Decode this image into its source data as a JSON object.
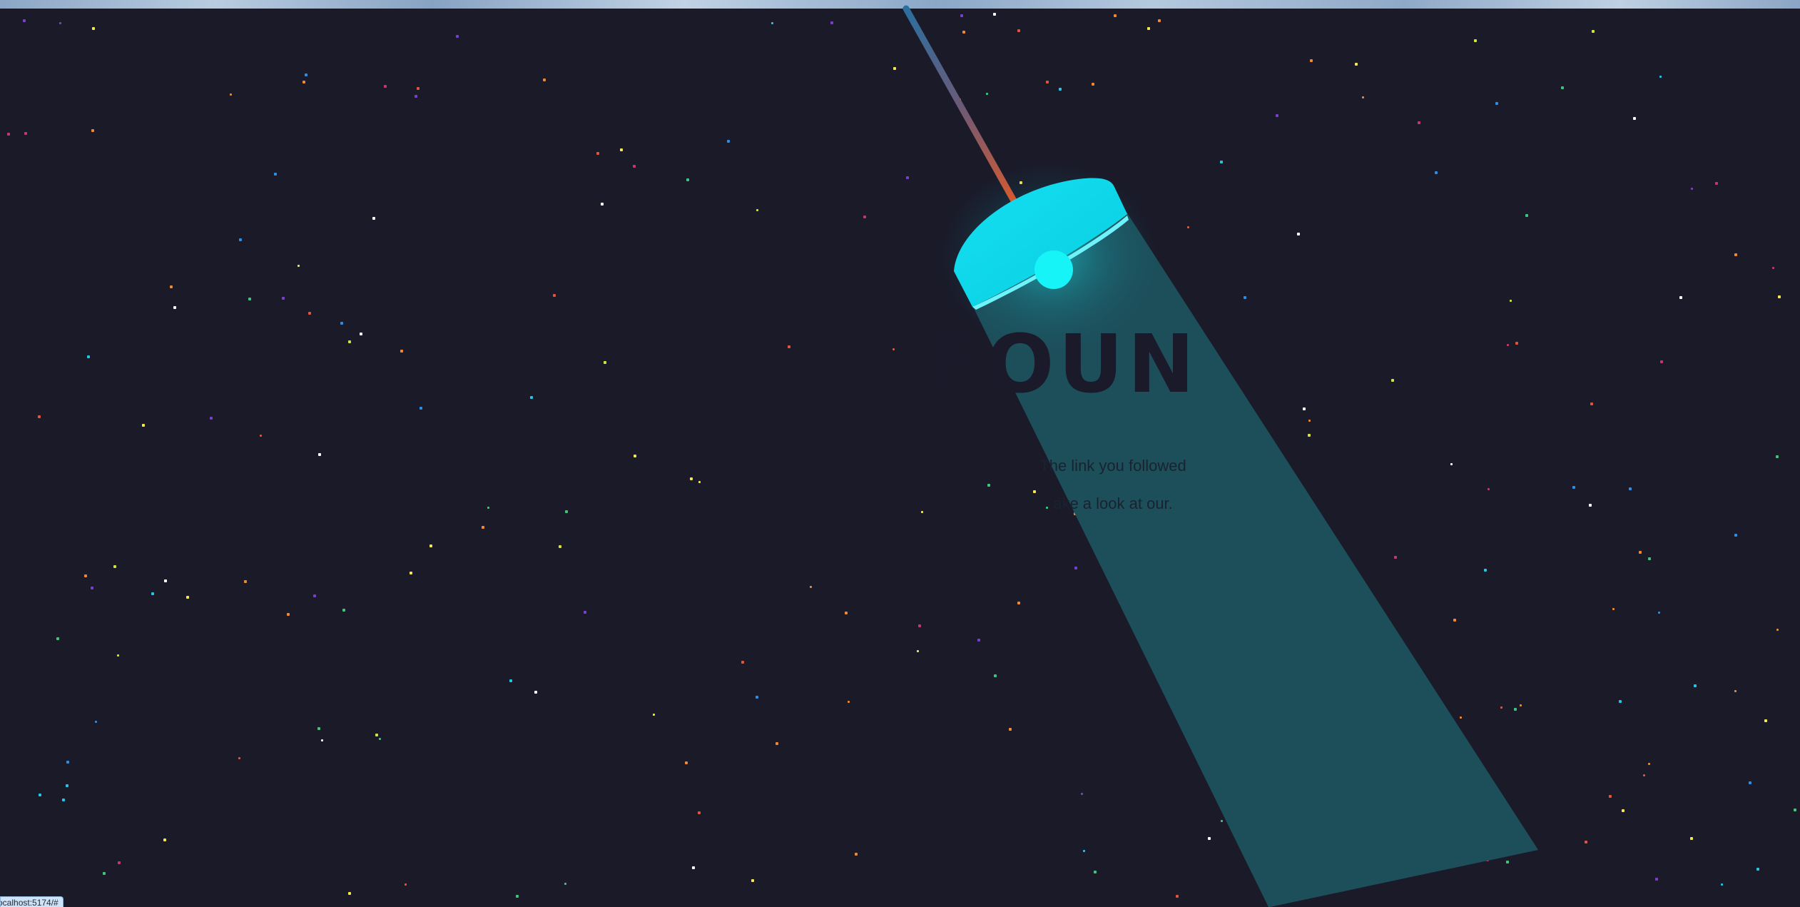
{
  "error_page": {
    "heading": "FOUN",
    "line_1": "The link you followed",
    "line_2": "ake a look at our."
  },
  "status_bar": {
    "link_preview": "ocalhost:5174/#"
  },
  "colors": {
    "background": "#1a1a29",
    "lamp_shade": "#0fd9ea",
    "lamp_bulb": "#16f4f8",
    "light_beam": "#1d4f5b",
    "cord_top": "#2b6f9e",
    "cord_bottom": "#d65a2f"
  },
  "icons": {
    "lamp": "hanging-lamp-icon",
    "bulb": "light-bulb-icon"
  }
}
